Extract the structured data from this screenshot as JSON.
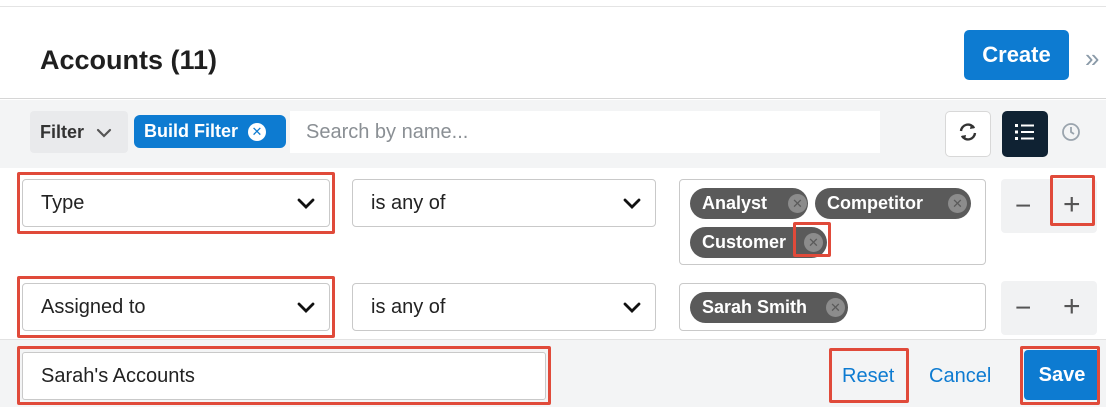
{
  "header": {
    "title": "Accounts (11)",
    "create_label": "Create",
    "expand_icon": "double-chevron-right-icon"
  },
  "filterbar": {
    "filter_label": "Filter",
    "build_filter_label": "Build Filter",
    "search_placeholder": "Search by name...",
    "refresh_icon": "refresh-icon",
    "list_view_icon": "list-view-icon",
    "activity_icon": "clock-icon"
  },
  "rows": [
    {
      "field": "Type",
      "operator": "is any of",
      "values": [
        "Analyst",
        "Competitor",
        "Customer"
      ]
    },
    {
      "field": "Assigned to",
      "operator": "is any of",
      "values": [
        "Sarah Smith"
      ]
    }
  ],
  "stepper": {
    "minus": "−",
    "plus": "+"
  },
  "footer": {
    "filter_name_value": "Sarah's Accounts",
    "reset_label": "Reset",
    "cancel_label": "Cancel",
    "save_label": "Save"
  },
  "colors": {
    "accent": "#0d7bd1",
    "highlight": "#e04a3a",
    "tag_bg": "#5a5a5a"
  }
}
